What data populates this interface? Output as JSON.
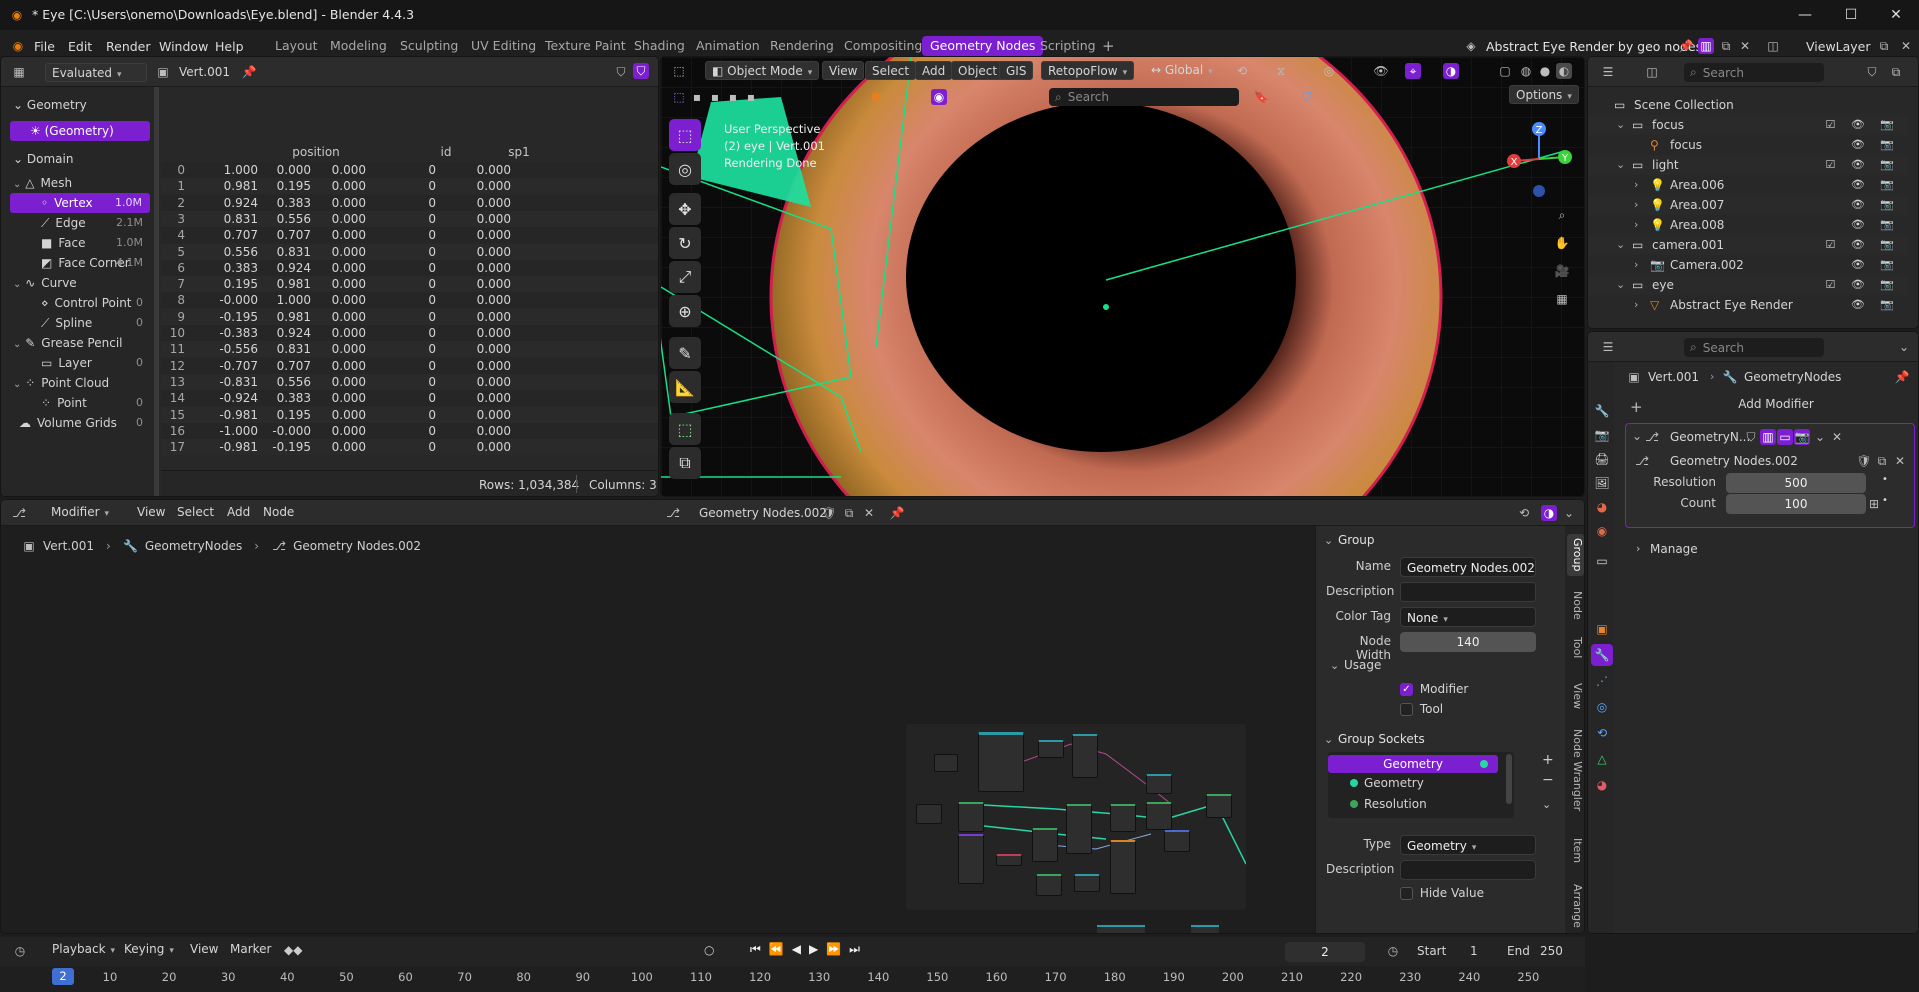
{
  "window": {
    "title": "* Eye [C:\\Users\\onemo\\Downloads\\Eye.blend] - Blender 4.4.3"
  },
  "menu": {
    "file": "File",
    "edit": "Edit",
    "render": "Render",
    "window": "Window",
    "help": "Help"
  },
  "workspaces": [
    "Layout",
    "Modeling",
    "Sculpting",
    "UV Editing",
    "Texture Paint",
    "Shading",
    "Animation",
    "Rendering",
    "Compositing",
    "Geometry Nodes",
    "Scripting"
  ],
  "active_workspace": "Geometry Nodes",
  "scene_name": "Abstract Eye Render by geo nodes",
  "view_layer": "ViewLayer",
  "spreadsheet": {
    "evaluated": "Evaluated",
    "object": "Vert.001",
    "geometry_label": "Geometry",
    "geometry_item": "(Geometry)",
    "domain_label": "Domain",
    "tree": [
      {
        "label": "Mesh",
        "count": "",
        "level": 0
      },
      {
        "label": "Vertex",
        "count": "1.0M",
        "level": 1,
        "selected": true
      },
      {
        "label": "Edge",
        "count": "2.1M",
        "level": 1
      },
      {
        "label": "Face",
        "count": "1.0M",
        "level": 1
      },
      {
        "label": "Face Corner",
        "count": "4.1M",
        "level": 1
      },
      {
        "label": "Curve",
        "count": "",
        "level": 0
      },
      {
        "label": "Control Point",
        "count": "0",
        "level": 1
      },
      {
        "label": "Spline",
        "count": "0",
        "level": 1
      },
      {
        "label": "Grease Pencil",
        "count": "",
        "level": 0
      },
      {
        "label": "Layer",
        "count": "0",
        "level": 1
      },
      {
        "label": "Point Cloud",
        "count": "",
        "level": 0
      },
      {
        "label": "Point",
        "count": "0",
        "level": 1
      },
      {
        "label": "Volume Grids",
        "count": "0",
        "level": 0
      }
    ],
    "columns": [
      "position",
      "id",
      "sp1"
    ],
    "rows": [
      [
        "0",
        "1.000",
        "0.000",
        "0.000",
        "0",
        "0.000"
      ],
      [
        "1",
        "0.981",
        "0.195",
        "0.000",
        "0",
        "0.000"
      ],
      [
        "2",
        "0.924",
        "0.383",
        "0.000",
        "0",
        "0.000"
      ],
      [
        "3",
        "0.831",
        "0.556",
        "0.000",
        "0",
        "0.000"
      ],
      [
        "4",
        "0.707",
        "0.707",
        "0.000",
        "0",
        "0.000"
      ],
      [
        "5",
        "0.556",
        "0.831",
        "0.000",
        "0",
        "0.000"
      ],
      [
        "6",
        "0.383",
        "0.924",
        "0.000",
        "0",
        "0.000"
      ],
      [
        "7",
        "0.195",
        "0.981",
        "0.000",
        "0",
        "0.000"
      ],
      [
        "8",
        "-0.000",
        "1.000",
        "0.000",
        "0",
        "0.000"
      ],
      [
        "9",
        "-0.195",
        "0.981",
        "0.000",
        "0",
        "0.000"
      ],
      [
        "10",
        "-0.383",
        "0.924",
        "0.000",
        "0",
        "0.000"
      ],
      [
        "11",
        "-0.556",
        "0.831",
        "0.000",
        "0",
        "0.000"
      ],
      [
        "12",
        "-0.707",
        "0.707",
        "0.000",
        "0",
        "0.000"
      ],
      [
        "13",
        "-0.831",
        "0.556",
        "0.000",
        "0",
        "0.000"
      ],
      [
        "14",
        "-0.924",
        "0.383",
        "0.000",
        "0",
        "0.000"
      ],
      [
        "15",
        "-0.981",
        "0.195",
        "0.000",
        "0",
        "0.000"
      ],
      [
        "16",
        "-1.000",
        "-0.000",
        "0.000",
        "0",
        "0.000"
      ],
      [
        "17",
        "-0.981",
        "-0.195",
        "0.000",
        "0",
        "0.000"
      ]
    ],
    "footer_rows": "Rows: 1,034,384",
    "footer_cols": "Columns: 3"
  },
  "viewport": {
    "mode": "Object Mode",
    "view": "View",
    "select": "Select",
    "add": "Add",
    "object": "Object",
    "gis": "GIS",
    "retopo": "RetopoFlow",
    "orientation": "Global",
    "search_placeholder": "Search",
    "options": "Options",
    "overlay_line1": "User Perspective",
    "overlay_line2": "(2) eye | Vert.001",
    "overlay_line3": "Rendering Done"
  },
  "outliner": {
    "search_placeholder": "Search",
    "rows": [
      {
        "label": "Scene Collection",
        "level": 0
      },
      {
        "label": "focus",
        "level": 1
      },
      {
        "label": "focus",
        "level": 2
      },
      {
        "label": "light",
        "level": 1
      },
      {
        "label": "Area.006",
        "level": 2
      },
      {
        "label": "Area.007",
        "level": 2
      },
      {
        "label": "Area.008",
        "level": 2
      },
      {
        "label": "camera.001",
        "level": 1
      },
      {
        "label": "Camera.002",
        "level": 2
      },
      {
        "label": "eye",
        "level": 1
      },
      {
        "label": "Abstract Eye Render",
        "level": 2
      }
    ]
  },
  "properties": {
    "search_placeholder": "Search",
    "breadcrumb_obj": "Vert.001",
    "breadcrumb_mod": "GeometryNodes",
    "add_modifier": "Add Modifier",
    "modifier_name": "GeometryN...",
    "node_group": "Geometry Nodes.002",
    "resolution_label": "Resolution",
    "resolution": "500",
    "count_label": "Count",
    "count": "100",
    "manage": "Manage"
  },
  "node_editor": {
    "editor": "Modifier",
    "view": "View",
    "select": "Select",
    "add": "Add",
    "node": "Node",
    "tree_name": "Geometry Nodes.002",
    "bc_obj": "Vert.001",
    "bc_mod": "GeometryNodes",
    "bc_tree": "Geometry Nodes.002",
    "side_tabs": [
      "Group",
      "Node",
      "Tool",
      "View",
      "Node Wrangler",
      "Item",
      "Arrange"
    ],
    "group": {
      "header": "Group",
      "name_label": "Name",
      "name": "Geometry Nodes.002",
      "desc_label": "Description",
      "color_label": "Color Tag",
      "color": "None",
      "width_label": "Node Width",
      "width": "140",
      "usage": "Usage",
      "modifier": "Modifier",
      "tool": "Tool",
      "sockets_header": "Group Sockets",
      "sockets": [
        "Geometry",
        "Geometry",
        "Resolution"
      ],
      "type_label": "Type",
      "type": "Geometry",
      "desc2_label": "Description",
      "hide_value": "Hide Value"
    }
  },
  "timeline": {
    "playback": "Playback",
    "keying": "Keying",
    "view": "View",
    "marker": "Marker",
    "current": "2",
    "start_label": "Start",
    "start": "1",
    "end_label": "End",
    "end": "250",
    "ticks": [
      "10",
      "20",
      "30",
      "40",
      "50",
      "60",
      "70",
      "80",
      "90",
      "100",
      "110",
      "120",
      "130",
      "140",
      "150",
      "160",
      "170",
      "180",
      "190",
      "200",
      "210",
      "220",
      "230",
      "240",
      "250"
    ],
    "current_marker": "2"
  }
}
